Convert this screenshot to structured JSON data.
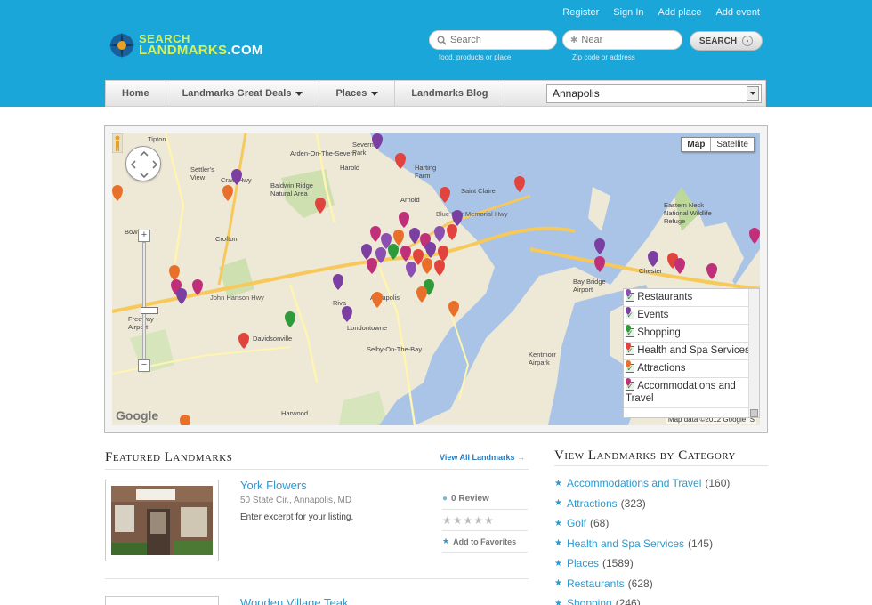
{
  "header": {
    "logo_line1": "SEARCH",
    "logo_line2": "LANDMARKS",
    "logo_suffix": ".COM",
    "top_links": [
      "Register",
      "Sign In",
      "Add place",
      "Add event"
    ],
    "search_placeholder": "Search",
    "search_hint": "food, products or place",
    "near_placeholder": "Near",
    "near_hint": "Zip code or address",
    "search_button": "SEARCH"
  },
  "nav": {
    "items": [
      "Home",
      "Landmarks Great Deals",
      "Places",
      "Landmarks Blog"
    ],
    "city": "Annapolis"
  },
  "map": {
    "type_map": "Map",
    "type_satellite": "Satellite",
    "google": "Google",
    "copyright": "Map data ©2012 Google, S",
    "legend": [
      {
        "label": "Restaurants",
        "color": "#8a4fb0"
      },
      {
        "label": "Events",
        "color": "#7a3fa0"
      },
      {
        "label": "Shopping",
        "color": "#2e9a3a"
      },
      {
        "label": "Health and Spa Services",
        "color": "#e0443c"
      },
      {
        "label": "Attractions",
        "color": "#e8702a"
      },
      {
        "label": "Accommodations and Travel",
        "color": "#c0307a"
      }
    ],
    "place_labels": [
      "Tipton",
      "Severna Park",
      "Arden-On-The-Severn",
      "Harold",
      "Harting Farm",
      "Settler's View",
      "Crain Hwy",
      "Baldwin Ridge Natural Area",
      "Arnold",
      "Saint Claire",
      "Bowie",
      "Crofton",
      "Annapolis",
      "Riva",
      "Davidsonville",
      "Londontowne",
      "Selby-On-The-Bay",
      "Harwood",
      "Chester",
      "Bay Bridge Airport",
      "Kentmorr Airpark",
      "Eastern Neck National Wildlife Refuge",
      "John Hanson Hwy",
      "Blue Star Memorial Hwy",
      "Freeway Airport"
    ]
  },
  "featured": {
    "title": "Featured Landmarks",
    "view_all": "View All Landmarks",
    "listings": [
      {
        "name": "York Flowers",
        "address": "50 State Cir., Annapolis, MD",
        "excerpt": "Enter excerpt for your listing.",
        "reviews": "0 Review",
        "favorite": "Add to Favorites",
        "stars": "★★★★★"
      },
      {
        "name": "Wooden Village Teak"
      }
    ]
  },
  "categories": {
    "title": "View Landmarks by Category",
    "items": [
      {
        "name": "Accommodations and Travel",
        "count": "(160)"
      },
      {
        "name": "Attractions",
        "count": "(323)"
      },
      {
        "name": "Golf",
        "count": "(68)"
      },
      {
        "name": "Health and Spa Services",
        "count": "(145)"
      },
      {
        "name": "Places",
        "count": "(1589)"
      },
      {
        "name": "Restaurants",
        "count": "(628)"
      },
      {
        "name": "Shopping",
        "count": "(246)"
      }
    ]
  }
}
